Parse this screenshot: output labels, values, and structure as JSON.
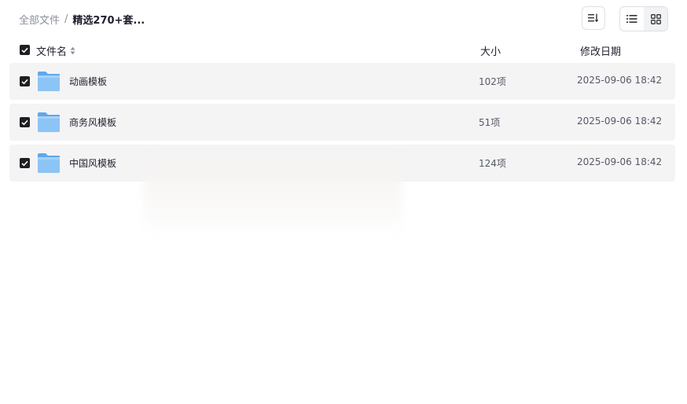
{
  "breadcrumb": {
    "root": "全部文件",
    "separator": "/",
    "current": "精选270+套..."
  },
  "toolbar": {
    "sort_icon": "sort-icon",
    "list_view_icon": "list-view-icon",
    "grid_view_icon": "grid-view-icon",
    "active_view": "list"
  },
  "table": {
    "columns": {
      "name": "文件名",
      "size": "大小",
      "date": "修改日期"
    },
    "rows": [
      {
        "name": "动画模板",
        "size": "102项",
        "date": "2025-09-06 18:42",
        "checked": true
      },
      {
        "name": "商务风模板",
        "size": "51项",
        "date": "2025-09-06 18:42",
        "checked": true
      },
      {
        "name": "中国风模板",
        "size": "124项",
        "date": "2025-09-06 18:42",
        "checked": true
      }
    ]
  },
  "colors": {
    "row_bg": "#f4f4f5",
    "checkbox": "#1f1f23",
    "folder_front": "#8cc4f5",
    "folder_back": "#5fa8ec"
  }
}
